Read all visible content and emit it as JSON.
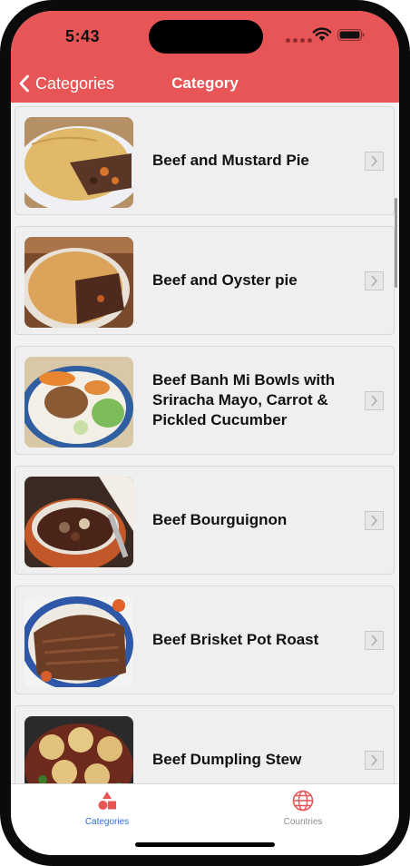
{
  "status_bar": {
    "time": "5:43"
  },
  "nav": {
    "back_label": "Categories",
    "title": "Category"
  },
  "meals": [
    {
      "title": "Beef and Mustard Pie"
    },
    {
      "title": "Beef and Oyster pie"
    },
    {
      "title": "Beef Banh Mi Bowls with Sriracha Mayo, Carrot & Pickled Cucumber"
    },
    {
      "title": "Beef Bourguignon"
    },
    {
      "title": "Beef Brisket Pot Roast"
    },
    {
      "title": "Beef Dumpling Stew"
    }
  ],
  "tabs": [
    {
      "label": "Categories",
      "icon": "shapes-icon",
      "selected": true
    },
    {
      "label": "Countries",
      "icon": "globe-icon",
      "selected": false
    }
  ],
  "colors": {
    "accent": "#e85556",
    "tab_selected": "#2a6fd6",
    "tab_unselected": "#8e8e8e"
  }
}
